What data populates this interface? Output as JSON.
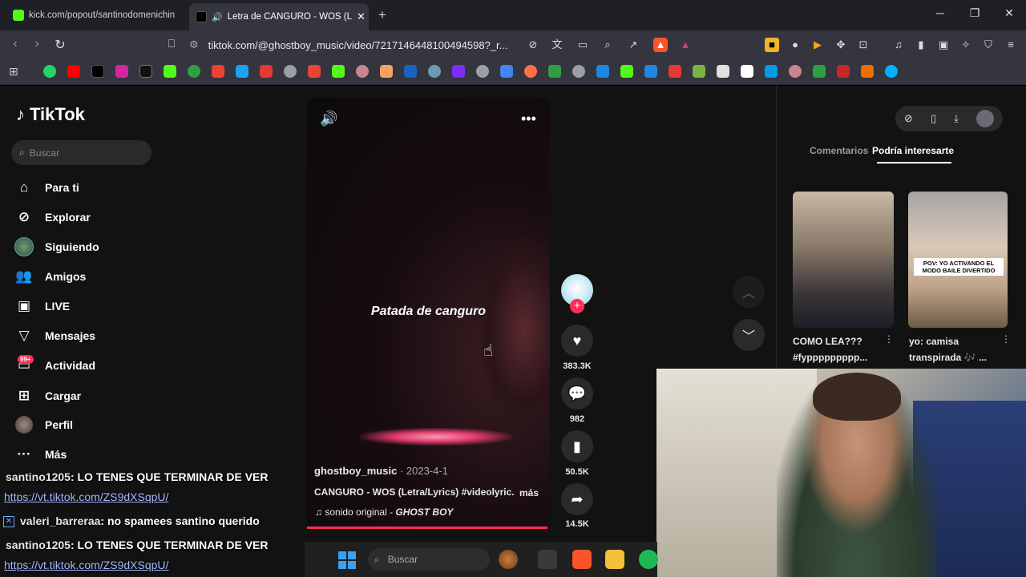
{
  "browser": {
    "tabs": [
      {
        "title": "kick.com/popout/santinodomenichin",
        "active": false
      },
      {
        "title": "Letra de CANGURO - WOS (L",
        "active": true
      }
    ],
    "new_tab": "+",
    "url": "tiktok.com/@ghostboy_music/video/7217146448100494598?_r..."
  },
  "sidebar": {
    "brand": "TikTok",
    "search_placeholder": "Buscar",
    "items": [
      {
        "label": "Para ti",
        "icon": "home-icon"
      },
      {
        "label": "Explorar",
        "icon": "compass-icon"
      },
      {
        "label": "Siguiendo",
        "icon": "following-avatar"
      },
      {
        "label": "Amigos",
        "icon": "friends-icon"
      },
      {
        "label": "LIVE",
        "icon": "live-icon"
      },
      {
        "label": "Mensajes",
        "icon": "message-icon"
      },
      {
        "label": "Actividad",
        "icon": "activity-icon"
      },
      {
        "label": "Cargar",
        "icon": "upload-icon"
      },
      {
        "label": "Perfil",
        "icon": "profile-avatar"
      },
      {
        "label": "Más",
        "icon": "more-icon"
      }
    ],
    "activity_badge": "99+"
  },
  "video": {
    "caption": "Patada de canguro",
    "author": "ghostboy_music",
    "date": "2023-4-1",
    "description": "CANGURO - WOS (Letra/Lyrics) #videolyric...",
    "more_label": "más",
    "sound": "sonido original - ",
    "sound_artist": "GHOST BOY",
    "likes": "383.3K",
    "comments": "982",
    "saves": "50.5K",
    "shares": "14.5K"
  },
  "right_panel": {
    "tabs": [
      "Comentarios",
      "Podría interesarte"
    ],
    "thumbs": [
      {
        "caption_line1": "COMO LEA???",
        "caption_line2": "#fyppppppppp..."
      },
      {
        "caption_line1": "yo: camisa",
        "caption_line2": "transpirada 🎶 ...",
        "overlay": "POV: YO ACTIVANDO EL MODO BAILE DIVERTIDO"
      }
    ]
  },
  "chat": [
    {
      "user": "santino1205",
      "message": ": LO TENES QUE TERMINAR DE VER"
    },
    {
      "link": "https://vt.tiktok.com/ZS9dXSqpU/"
    },
    {
      "user": "valeri_barreraa",
      "message": ": no spamees santino querido"
    },
    {
      "user": "santino1205",
      "message": ": LO TENES QUE TERMINAR DE VER"
    },
    {
      "link": "https://vt.tiktok.com/ZS9dXSqpU/"
    }
  ],
  "taskbar": {
    "search_placeholder": "Buscar"
  },
  "colors": {
    "accent": "#fe2c55",
    "background": "#121212"
  }
}
